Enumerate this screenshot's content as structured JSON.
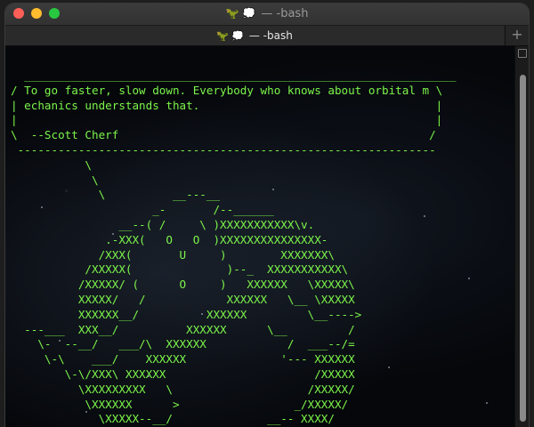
{
  "window": {
    "title_icons": "🦖 💭",
    "title": "— -bash",
    "tab_icons": "🦖 💭",
    "tab_title": "— -bash",
    "new_tab_label": "+"
  },
  "terminal": {
    "lines": [
      "  ________________________________________________________________",
      "/ To go faster, slow down. Everybody who knows about orbital m \\",
      "| echanics understands that.                                   |",
      "|                                                              |",
      "\\  --Scott Cherf                                              /",
      " --------------------------------------------------------------",
      "           \\",
      "            \\",
      "             \\          __---__",
      "                     _-       /--______",
      "                __--( /     \\ )XXXXXXXXXXX\\v.",
      "              .-XXX(   O   O  )XXXXXXXXXXXXXXX-",
      "             /XXX(       U     )        XXXXXXX\\",
      "           /XXXXX(              )--_  XXXXXXXXXXX\\",
      "          /XXXXX/ (      O     )   XXXXXX   \\XXXXX\\",
      "          XXXXX/   /            XXXXXX   \\__ \\XXXXX",
      "          XXXXXX__/          XXXXXX         \\__---->",
      "  ---___  XXX__/          XXXXXX      \\__         /",
      "    \\-  --__/   ___/\\  XXXXXX            /  ___--/=",
      "     \\-\\    ___/    XXXXXX              '--- XXXXXX",
      "        \\-\\/XXX\\ XXXXXX                      /XXXXX",
      "          \\XXXXXXXXX   \\                    /XXXXX/",
      "           \\XXXXXX      >                 _/XXXXX/",
      "             \\XXXXX--__/              __-- XXXX/"
    ]
  }
}
